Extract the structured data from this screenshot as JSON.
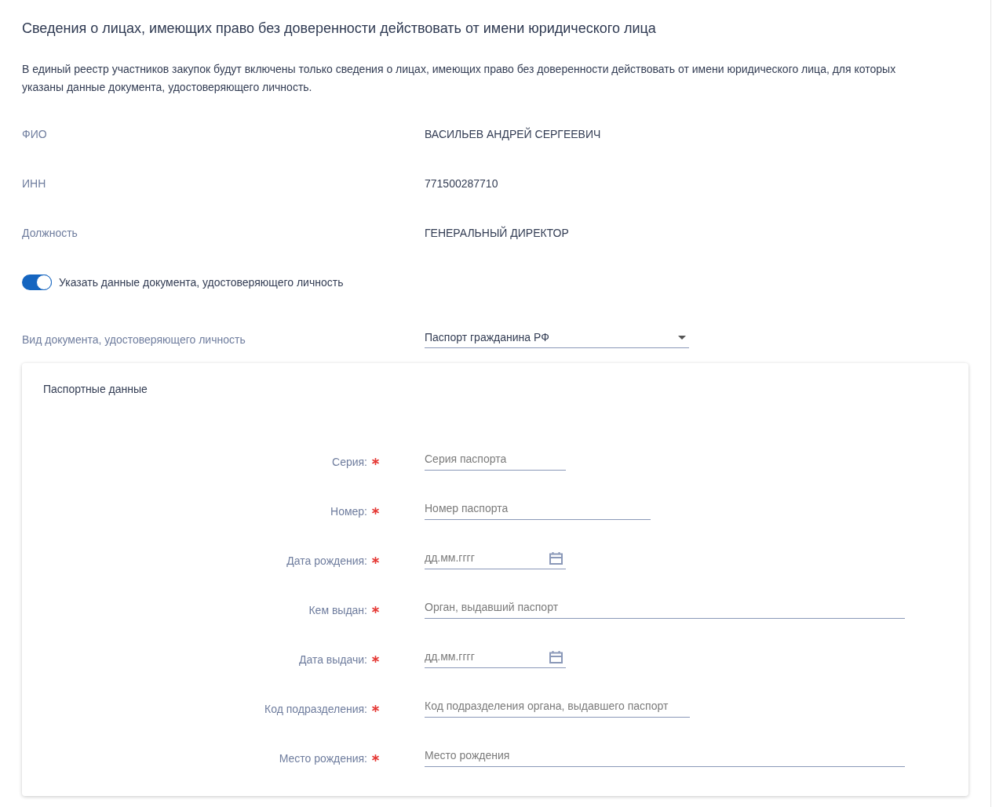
{
  "section": {
    "title": "Сведения о лицах, имеющих право без доверенности действовать от имени юридического лица",
    "note": "В единый реестр участников закупок будут включены только сведения о лицах, имеющих право без доверенности действовать от имени юридического лица, для которых указаны данные документа, удостоверяющего личность."
  },
  "details": [
    {
      "label": "ФИО",
      "value": "ВАСИЛЬЕВ АНДРЕЙ СЕРГЕЕВИЧ"
    },
    {
      "label": "ИНН",
      "value": "771500287710"
    },
    {
      "label": "Должность",
      "value": "ГЕНЕРАЛЬНЫЙ ДИРЕКТОР"
    }
  ],
  "id_toggle": {
    "label": "Указать данные документа, удостоверяющего личность",
    "on": true
  },
  "document_type": {
    "label": "Вид документа, удостоверяющего личность",
    "value": "Паспорт гражданина РФ"
  },
  "passport": {
    "title": "Паспортные данные",
    "fields": [
      {
        "kind": "text",
        "label": "Серия:",
        "required": true,
        "placeholder": "Серия паспорта"
      },
      {
        "kind": "text",
        "label": "Номер:",
        "required": true,
        "placeholder": "Номер паспорта"
      },
      {
        "kind": "date",
        "label": "Дата рождения:",
        "required": true,
        "placeholder": "дд.мм.гггг"
      },
      {
        "kind": "text",
        "label": "Кем выдан:",
        "required": true,
        "placeholder": "Орган, выдавший паспорт"
      },
      {
        "kind": "date",
        "label": "Дата выдачи:",
        "required": true,
        "placeholder": "дд.мм.гггг"
      },
      {
        "kind": "text",
        "label": "Код подразделения:",
        "required": true,
        "placeholder": "Код подразделения органа, выдавшего паспорт"
      },
      {
        "kind": "text",
        "label": "Место рождения:",
        "required": true,
        "placeholder": "Место рождения"
      }
    ]
  }
}
